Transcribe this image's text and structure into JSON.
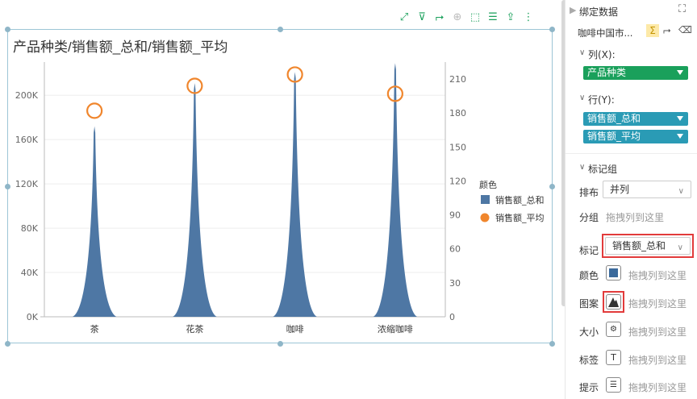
{
  "chart_title": "产品种类/销售额_总和/销售额_平均",
  "toolbar": {
    "icons": [
      "expand-icon",
      "filter-icon",
      "axis-swap-icon",
      "zoom-icon",
      "select-icon",
      "list-icon",
      "export-icon",
      "more-icon"
    ]
  },
  "chart_data": {
    "type": "area",
    "categories": [
      "茶",
      "花茶",
      "咖啡",
      "浓缩咖啡"
    ],
    "series": [
      {
        "name": "销售额_总和",
        "kind": "spike-area",
        "axis": "left",
        "color": "#4e77a4",
        "values": [
          172000,
          211000,
          221000,
          229000
        ]
      },
      {
        "name": "销售额_平均",
        "kind": "circle",
        "axis": "right",
        "color": "#f0862d",
        "values": [
          182,
          204,
          214,
          197
        ]
      }
    ],
    "ylim_left": [
      0,
      230000
    ],
    "yticks_left": [
      "0K",
      "40K",
      "80K",
      "120K",
      "160K",
      "200K"
    ],
    "ylim_right": [
      0,
      225
    ],
    "yticks_right": [
      "0",
      "30",
      "60",
      "90",
      "120",
      "150",
      "180",
      "210"
    ],
    "legend": {
      "title": "颜色",
      "items": [
        "销售额_总和",
        "销售额_平均"
      ],
      "position": "right"
    },
    "grid": true
  },
  "panel": {
    "header_title": "绑定数据",
    "dataset_name": "咖啡中国市...",
    "columns_label": "列(X):",
    "columns_field": "产品种类",
    "rows_label": "行(Y):",
    "rows_fields": [
      "销售额_总和",
      "销售额_平均"
    ],
    "marks_group_label": "标记组",
    "layout_label": "排布",
    "layout_value": "并列",
    "group_label": "分组",
    "drop_hint": "拖拽列到这里",
    "mark_label": "标记",
    "mark_value": "销售额_总和",
    "properties": [
      "颜色",
      "图案",
      "大小",
      "标签",
      "提示"
    ],
    "colors": {
      "green": "#1aa05b",
      "teal": "#2a9bb5",
      "highlight": "#e23b3b"
    }
  }
}
